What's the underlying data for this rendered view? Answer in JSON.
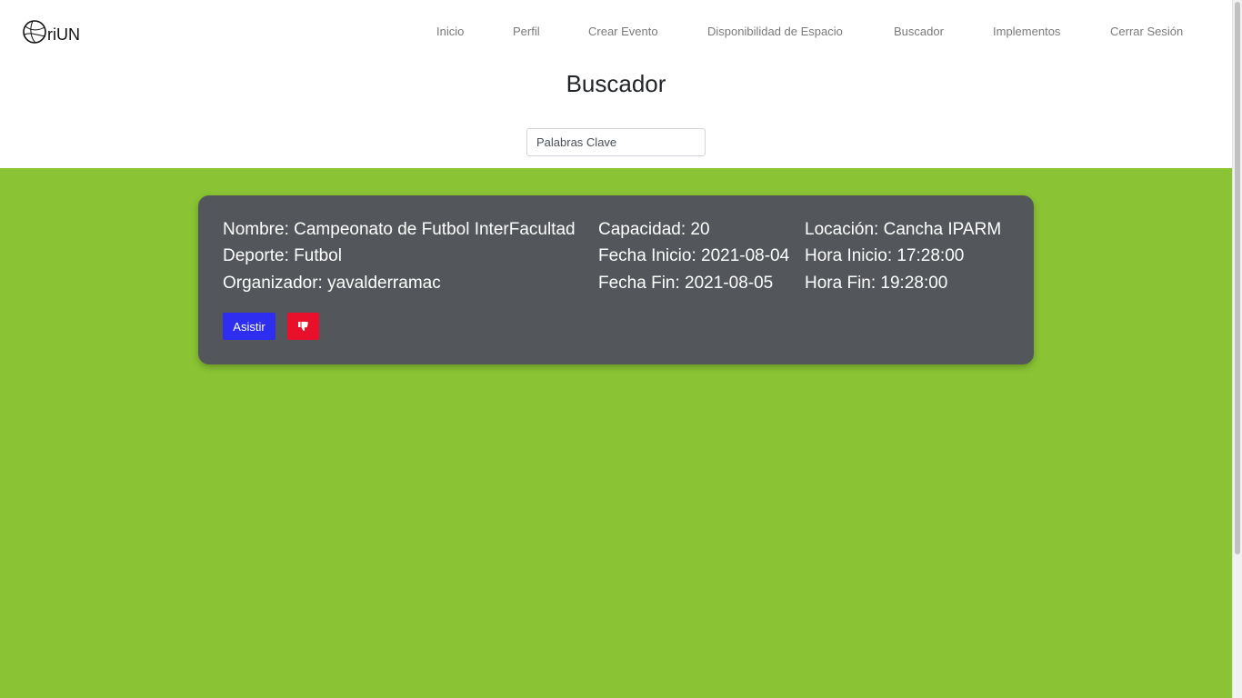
{
  "brand": {
    "logo_text": "riUN"
  },
  "nav": {
    "items": [
      {
        "label": "Inicio"
      },
      {
        "label": "Perfil"
      },
      {
        "label": "Crear Evento"
      },
      {
        "label": "Disponibilidad de Espacio"
      },
      {
        "label": "Buscador"
      },
      {
        "label": "Implementos"
      },
      {
        "label": "Cerrar Sesión"
      }
    ]
  },
  "page": {
    "title": "Buscador"
  },
  "search": {
    "placeholder": "Palabras Clave",
    "value": ""
  },
  "event": {
    "nombre": "Nombre: Campeonato de Futbol InterFacultad",
    "deporte": "Deporte: Futbol",
    "organizador": "Organizador: yavalderramac",
    "capacidad": "Capacidad: 20",
    "fecha_inicio": "Fecha Inicio: 2021-08-04",
    "fecha_fin": "Fecha Fin: 2021-08-05",
    "locacion": "Locación: Cancha IPARM",
    "hora_inicio": "Hora Inicio: 17:28:00",
    "hora_fin": "Hora Fin: 19:28:00",
    "attend_label": "Asistir",
    "dislike_icon": "thumbs-down-icon"
  },
  "colors": {
    "main_background": "#8ac434",
    "card_background": "#53565a",
    "attend_button": "#2e2ef0",
    "dislike_button": "#e8102a",
    "nav_text": "#7a7a7a"
  }
}
